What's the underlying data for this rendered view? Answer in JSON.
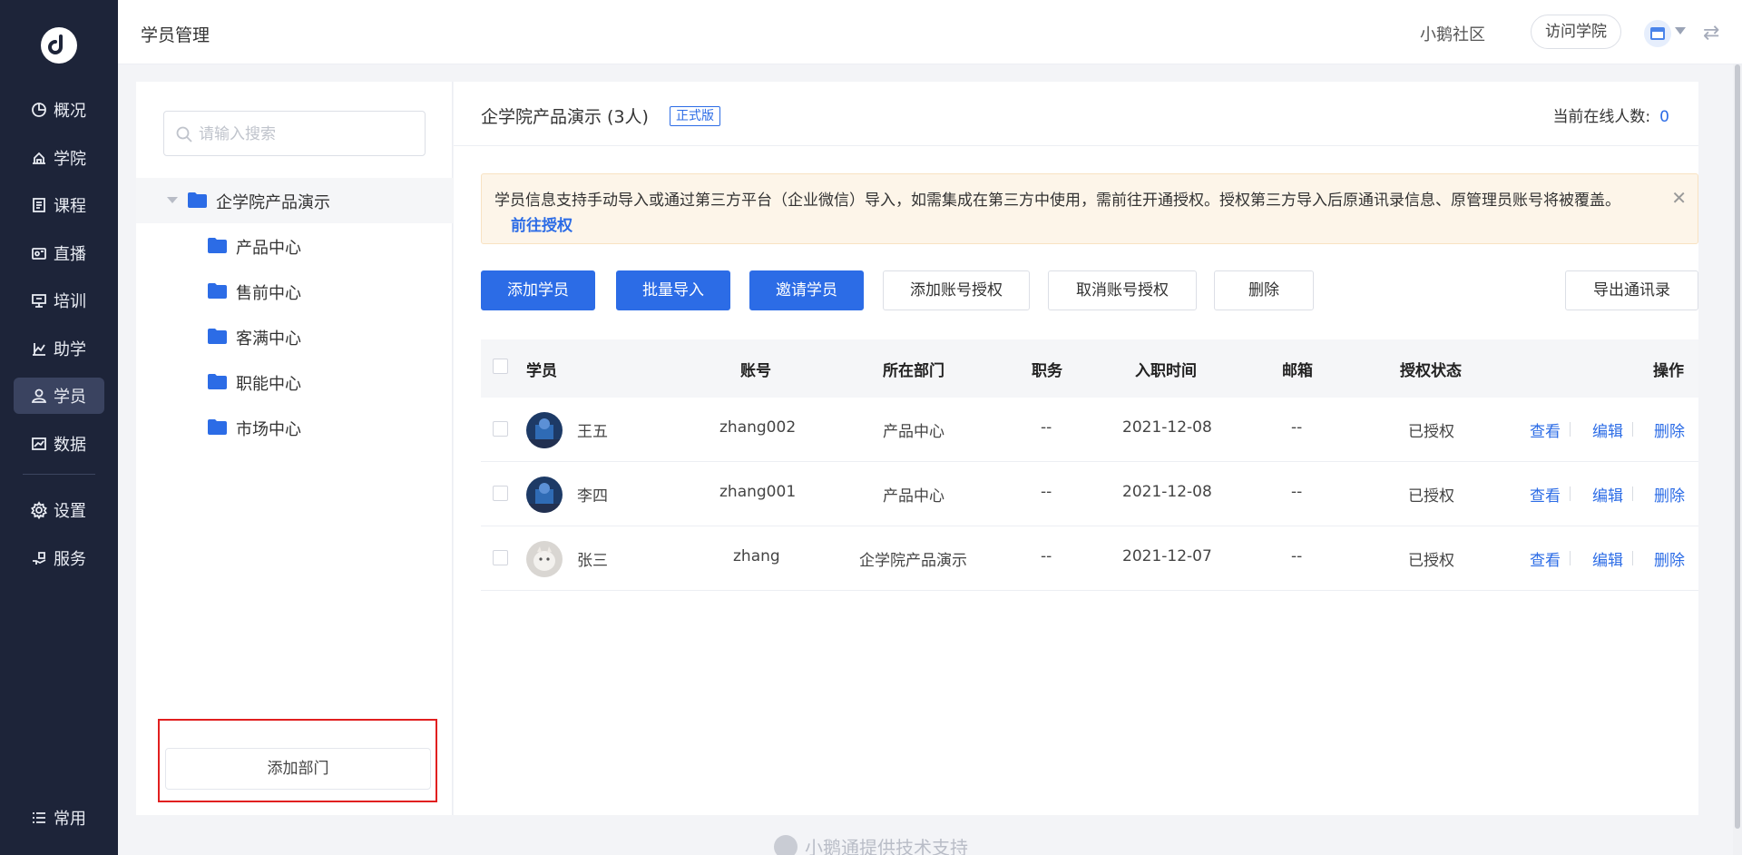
{
  "sidebar": {
    "items": [
      {
        "label": "概况",
        "icon": "pie-chart-icon"
      },
      {
        "label": "学院",
        "icon": "academy-icon"
      },
      {
        "label": "课程",
        "icon": "course-icon"
      },
      {
        "label": "直播",
        "icon": "live-icon"
      },
      {
        "label": "培训",
        "icon": "training-icon"
      },
      {
        "label": "助学",
        "icon": "study-aid-icon"
      },
      {
        "label": "学员",
        "icon": "user-icon",
        "active": true
      },
      {
        "label": "数据",
        "icon": "data-icon"
      },
      {
        "label": "设置",
        "icon": "gear-icon"
      },
      {
        "label": "服务",
        "icon": "service-icon"
      }
    ],
    "bottom": {
      "label": "常用",
      "icon": "list-icon"
    }
  },
  "header": {
    "title": "学员管理",
    "community": "小鹅社区",
    "visit_label": "访问学院"
  },
  "dept": {
    "search_placeholder": "请输入搜索",
    "root": "企学院产品演示",
    "children": [
      "产品中心",
      "售前中心",
      "客满中心",
      "职能中心",
      "市场中心"
    ],
    "add_label": "添加部门"
  },
  "main": {
    "title": "企学院产品演示 (3人)",
    "badge": "正式版",
    "online_label": "当前在线人数:",
    "online_count": "0",
    "notice": "学员信息支持手动导入或通过第三方平台（企业微信）导入，如需集成在第三方中使用，需前往开通授权。授权第三方导入后原通讯录信息、原管理员账号将被覆盖。",
    "notice_link": "前往授权",
    "buttons": {
      "add_student": "添加学员",
      "batch_import": "批量导入",
      "invite": "邀请学员",
      "add_auth": "添加账号授权",
      "cancel_auth": "取消账号授权",
      "delete": "删除",
      "export": "导出通讯录"
    },
    "columns": {
      "student": "学员",
      "account": "账号",
      "department": "所在部门",
      "position": "职务",
      "join_date": "入职时间",
      "email": "邮箱",
      "auth_status": "授权状态",
      "actions": "操作"
    },
    "rows": [
      {
        "name": "王五",
        "account": "zhang002",
        "department": "产品中心",
        "position": "--",
        "join_date": "2021-12-08",
        "email": "--",
        "auth_status": "已授权"
      },
      {
        "name": "李四",
        "account": "zhang001",
        "department": "产品中心",
        "position": "--",
        "join_date": "2021-12-08",
        "email": "--",
        "auth_status": "已授权"
      },
      {
        "name": "张三",
        "account": "zhang",
        "department": "企学院产品演示",
        "position": "--",
        "join_date": "2021-12-07",
        "email": "--",
        "auth_status": "已授权"
      }
    ],
    "actions": {
      "view": "查看",
      "edit": "编辑",
      "delete": "删除"
    }
  },
  "footer": {
    "text": "小鹅通提供技术支持"
  },
  "colors": {
    "primary": "#2c6ce6",
    "sidebar": "#1d2439",
    "highlight": "#e11f1f"
  }
}
